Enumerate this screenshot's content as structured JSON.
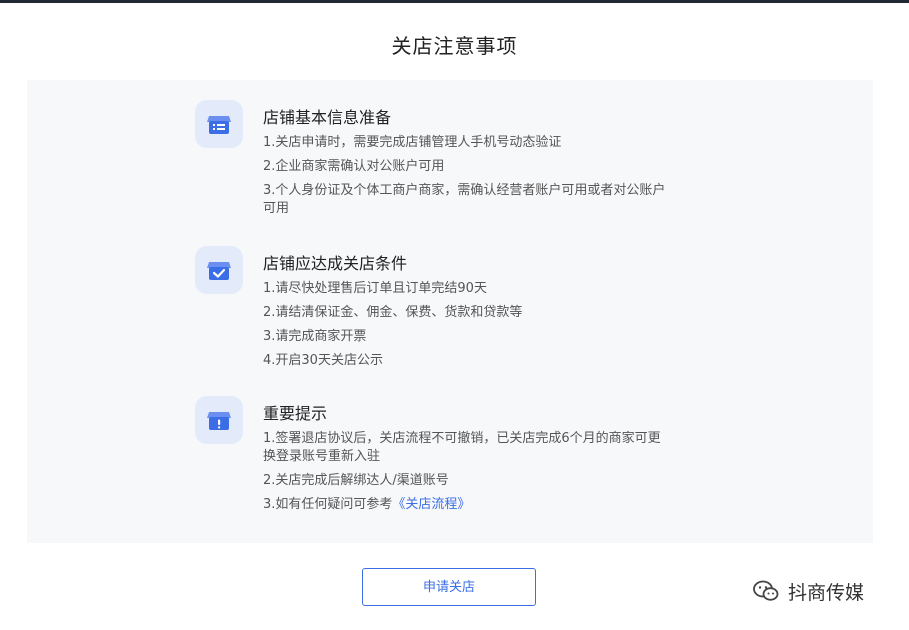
{
  "page": {
    "title": "关店注意事项"
  },
  "sections": [
    {
      "icon": "store-info-icon",
      "title": "店铺基本信息准备",
      "items": [
        "1.关店申请时，需要完成店铺管理人手机号动态验证",
        "2.企业商家需确认对公账户可用",
        "3.个人身份证及个体工商户商家，需确认经营者账户可用或者对公账户可用"
      ]
    },
    {
      "icon": "store-check-icon",
      "title": "店铺应达成关店条件",
      "items": [
        "1.请尽快处理售后订单且订单完结90天",
        "2.请结清保证金、佣金、保费、货款和贷款等",
        "3.请完成商家开票",
        "4.开启30天关店公示"
      ]
    },
    {
      "icon": "store-alert-icon",
      "title": "重要提示",
      "items": [
        "1.签署退店协议后，关店流程不可撤销，已关店完成6个月的商家可更换登录账号重新入驻",
        "2.关店完成后解绑达人/渠道账号"
      ],
      "last_item_prefix": "3.如有任何疑问可参考",
      "last_item_link": "《关店流程》"
    }
  ],
  "actions": {
    "apply_label": "申请关店"
  },
  "watermark": {
    "text": "抖商传媒",
    "icon": "wechat-icon"
  },
  "colors": {
    "accent": "#3b6ee6",
    "icon_bg": "#e3ebfb",
    "panel_bg": "#f7f8fa"
  }
}
